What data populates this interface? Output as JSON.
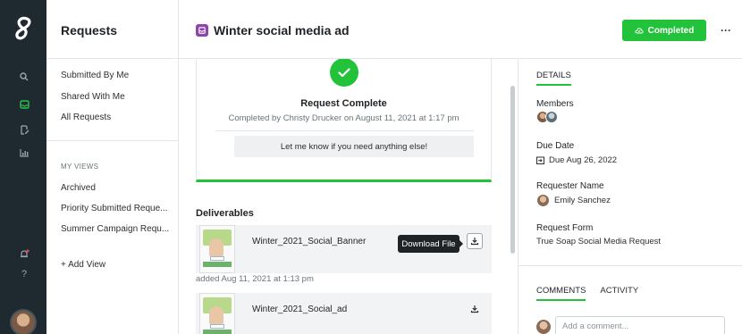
{
  "rail": {
    "icons": [
      "search-icon",
      "inbox-icon",
      "file-edit-icon",
      "chart-icon",
      "bell-icon",
      "help-icon"
    ],
    "accent": "#27c24c",
    "help_label": "?"
  },
  "sidebar": {
    "title": "Requests",
    "items": [
      {
        "label": "Submitted By Me"
      },
      {
        "label": "Shared With Me"
      },
      {
        "label": "All Requests"
      }
    ],
    "views_heading": "MY VIEWS",
    "views": [
      {
        "label": "Archived"
      },
      {
        "label": "Priority Submitted Reque..."
      },
      {
        "label": "Summer Campaign Requ..."
      }
    ],
    "add_view": "+ Add View"
  },
  "header": {
    "title": "Winter social media ad",
    "status_button": "Completed",
    "status_color": "#22c23b",
    "more": "···"
  },
  "completion": {
    "title": "Request Complete",
    "subtitle": "Completed by Christy Drucker on August 11, 2021 at 1:17 pm",
    "message": "Let me know if you need anything else!"
  },
  "deliverables": {
    "heading": "Deliverables",
    "items": [
      {
        "name": "Winter_2021_Social_Banner",
        "added": "added Aug 11, 2021 at 1:13 pm"
      },
      {
        "name": "Winter_2021_Social_ad"
      }
    ],
    "tooltip": "Download File"
  },
  "details": {
    "tab": "DETAILS",
    "members_label": "Members",
    "due_label": "Due Date",
    "due_value": "Due Aug 26, 2022",
    "requester_label": "Requester Name",
    "requester_value": "Emily Sanchez",
    "form_label": "Request Form",
    "form_value": "True Soap Social Media Request",
    "tabs": [
      "COMMENTS",
      "ACTIVITY"
    ],
    "comment_placeholder": "Add a comment..."
  }
}
